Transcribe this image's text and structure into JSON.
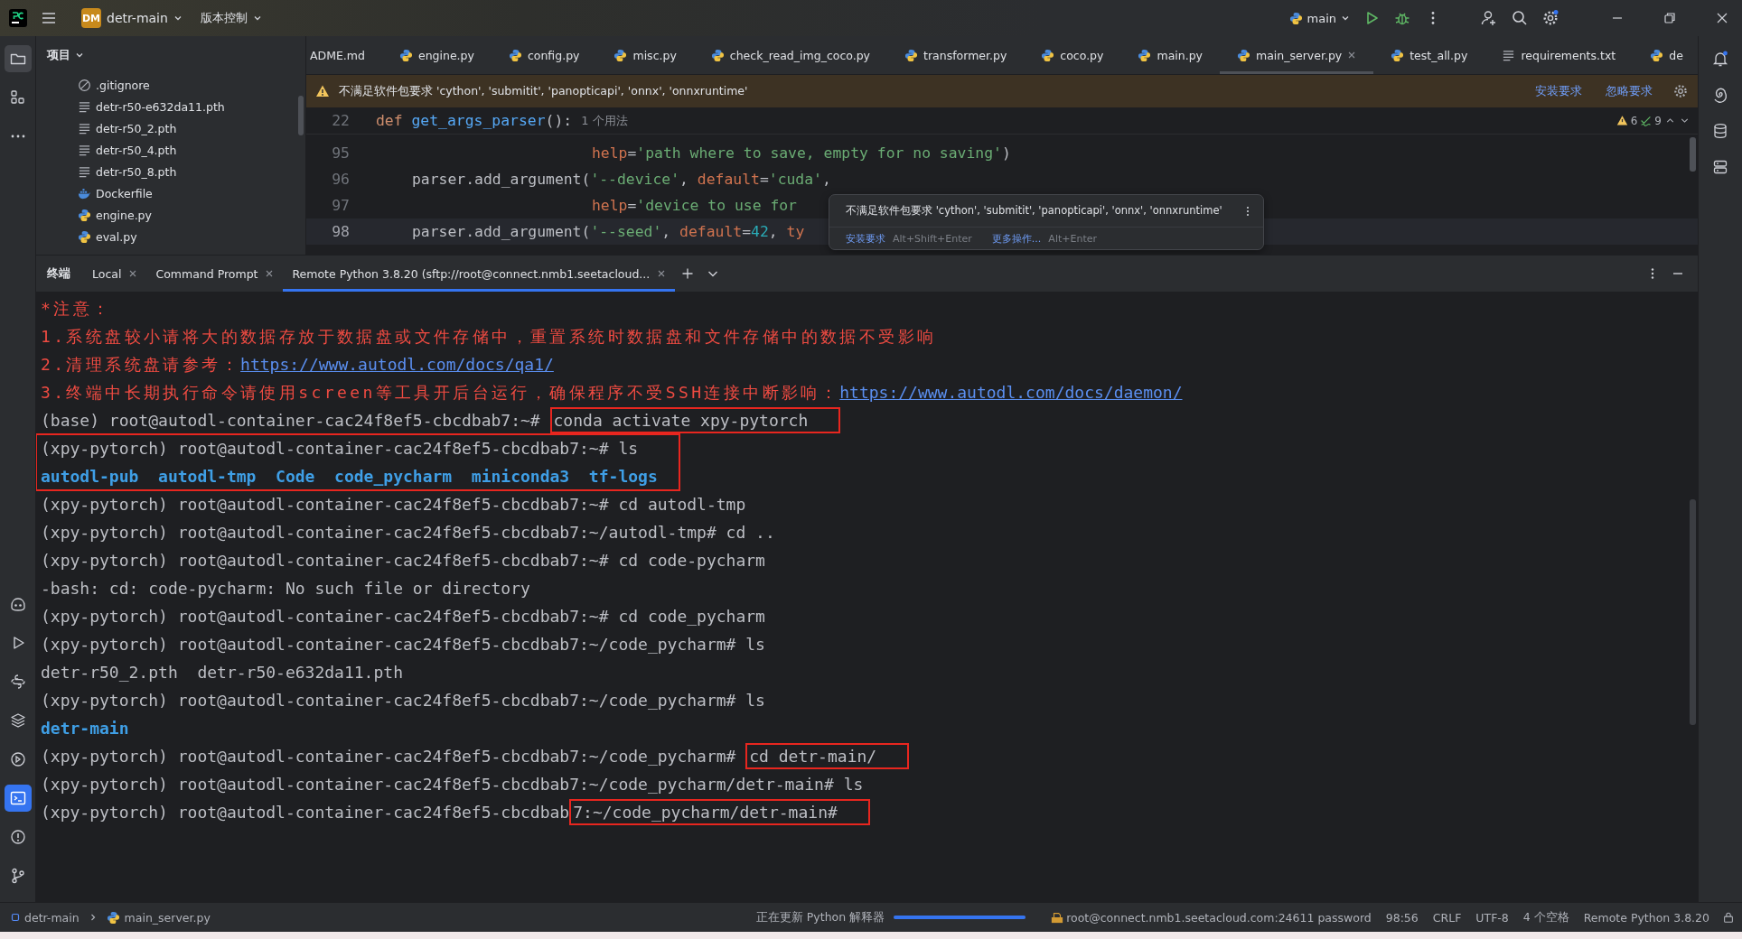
{
  "titlebar": {
    "project_badge": "DM",
    "project": "detr-main",
    "vcs": "版本控制",
    "run_config": "main"
  },
  "project_panel": {
    "title": "项目",
    "items": [
      {
        "name": ".gitignore",
        "kind": "ignore"
      },
      {
        "name": "detr-r50-e632da11.pth",
        "kind": "text"
      },
      {
        "name": "detr-r50_2.pth",
        "kind": "text"
      },
      {
        "name": "detr-r50_4.pth",
        "kind": "text"
      },
      {
        "name": "detr-r50_8.pth",
        "kind": "text"
      },
      {
        "name": "Dockerfile",
        "kind": "docker"
      },
      {
        "name": "engine.py",
        "kind": "python"
      },
      {
        "name": "eval.py",
        "kind": "python"
      }
    ]
  },
  "editor_tabs": [
    {
      "label": "ADME.md",
      "kind": "markdown",
      "selected": false
    },
    {
      "label": "engine.py",
      "kind": "python",
      "selected": false
    },
    {
      "label": "config.py",
      "kind": "python",
      "selected": false
    },
    {
      "label": "misc.py",
      "kind": "python",
      "selected": false
    },
    {
      "label": "check_read_img_coco.py",
      "kind": "python",
      "selected": false
    },
    {
      "label": "transformer.py",
      "kind": "python",
      "selected": false
    },
    {
      "label": "coco.py",
      "kind": "python",
      "selected": false
    },
    {
      "label": "main.py",
      "kind": "python",
      "selected": false
    },
    {
      "label": "main_server.py",
      "kind": "python",
      "selected": true
    },
    {
      "label": "test_all.py",
      "kind": "python",
      "selected": false
    },
    {
      "label": "requirements.txt",
      "kind": "text",
      "selected": false
    },
    {
      "label": "de",
      "kind": "python",
      "selected": false
    }
  ],
  "banner": {
    "message": "不满足软件包要求 'cython', 'submitit', 'panopticapi', 'onnx', 'onnxruntime'",
    "actions": [
      "安装要求",
      "忽略要求"
    ]
  },
  "inspections": {
    "warnings": "6",
    "weak_warnings": "9"
  },
  "editor": {
    "sticky": {
      "number": "22",
      "segments": [
        {
          "text": "def ",
          "kind": "keyword"
        },
        {
          "text": "get_args_parser",
          "kind": "function"
        },
        {
          "text": "():",
          "kind": "plain"
        }
      ],
      "hint": "1 个用法"
    },
    "lines": [
      {
        "number": "95",
        "kind": "continuation",
        "current": false,
        "segments": [
          {
            "text": "help",
            "kind": "param"
          },
          {
            "text": "=",
            "kind": "plain"
          },
          {
            "text": "'path where to save, empty for no saving'",
            "kind": "string"
          },
          {
            "text": ")",
            "kind": "plain"
          }
        ]
      },
      {
        "number": "96",
        "kind": "statement",
        "current": false,
        "segments": [
          {
            "text": "parser.add_argument(",
            "kind": "plain"
          },
          {
            "text": "'--device'",
            "kind": "string"
          },
          {
            "text": ", ",
            "kind": "plain"
          },
          {
            "text": "default",
            "kind": "param"
          },
          {
            "text": "=",
            "kind": "plain"
          },
          {
            "text": "'cuda'",
            "kind": "string"
          },
          {
            "text": ",",
            "kind": "plain"
          }
        ]
      },
      {
        "number": "97",
        "kind": "continuation",
        "current": false,
        "segments": [
          {
            "text": "help",
            "kind": "param"
          },
          {
            "text": "=",
            "kind": "plain"
          },
          {
            "text": "'device to use for",
            "kind": "string"
          }
        ]
      },
      {
        "number": "98",
        "kind": "statement",
        "current": true,
        "segments": [
          {
            "text": "parser.add_argument(",
            "kind": "plain"
          },
          {
            "text": "'--seed'",
            "kind": "string"
          },
          {
            "text": ", ",
            "kind": "plain"
          },
          {
            "text": "default",
            "kind": "param"
          },
          {
            "text": "=",
            "kind": "plain"
          },
          {
            "text": "42",
            "kind": "number"
          },
          {
            "text": ", ",
            "kind": "plain"
          },
          {
            "text": "ty",
            "kind": "param"
          }
        ]
      }
    ]
  },
  "popup": {
    "message": "不满足软件包要求 'cython', 'submitit', 'panopticapi', 'onnx', 'onnxruntime'",
    "actions": [
      {
        "label": "安装要求",
        "shortcut": "Alt+Shift+Enter"
      },
      {
        "label": "更多操作...",
        "shortcut": "Alt+Enter"
      }
    ]
  },
  "terminal": {
    "title": "终端",
    "tabs": [
      {
        "label": "Local",
        "selected": false
      },
      {
        "label": "Command Prompt",
        "selected": false
      },
      {
        "label": "Remote Python 3.8.20 (sftp://root@connect.nmb1.seetacloud...",
        "selected": true
      }
    ],
    "lines": [
      {
        "kind": "line",
        "segments": [
          {
            "text": "*注意：",
            "kind": "warning",
            "boxed": false
          }
        ]
      },
      {
        "kind": "line",
        "segments": [
          {
            "text": "1.系统盘较小请将大的数据存放于数据盘或文件存储中，重置系统时数据盘和文件存储中的数据不受影响",
            "kind": "warning",
            "boxed": false
          }
        ]
      },
      {
        "kind": "line",
        "segments": [
          {
            "text": "2.清理系统盘请参考：",
            "kind": "warning",
            "boxed": false
          },
          {
            "text": "https://www.autodl.com/docs/qa1/",
            "kind": "link",
            "boxed": false
          }
        ]
      },
      {
        "kind": "line",
        "segments": [
          {
            "text": "3.终端中长期执行命令请使用screen等工具开后台运行，确保程序不受SSH连接中断影响：",
            "kind": "warning",
            "boxed": false
          },
          {
            "text": "https://www.autodl.com/docs/daemon/",
            "kind": "link",
            "boxed": false
          }
        ]
      },
      {
        "kind": "line",
        "segments": [
          {
            "text": "(base) root@autodl-container-cac24f8ef5-cbcdbab7:~# ",
            "kind": "plain",
            "boxed": false
          },
          {
            "text": "conda activate xpy-pytorch",
            "kind": "plain",
            "boxed": true
          }
        ]
      },
      {
        "kind": "boxed_block",
        "lines": [
          {
            "segments": [
              {
                "text": "(xpy-pytorch) root@autodl-container-cac24f8ef5-cbcdbab7:~# ls",
                "kind": "plain",
                "boxed": false
              }
            ]
          },
          {
            "segments": [
              {
                "text": "autodl-pub  autodl-tmp  Code  code_pycharm  miniconda3  tf-logs",
                "kind": "dir",
                "boxed": false
              }
            ]
          }
        ]
      },
      {
        "kind": "line",
        "segments": [
          {
            "text": "(xpy-pytorch) root@autodl-container-cac24f8ef5-cbcdbab7:~# cd autodl-tmp",
            "kind": "plain",
            "boxed": false
          }
        ]
      },
      {
        "kind": "line",
        "segments": [
          {
            "text": "(xpy-pytorch) root@autodl-container-cac24f8ef5-cbcdbab7:~/autodl-tmp# cd ..",
            "kind": "plain",
            "boxed": false
          }
        ]
      },
      {
        "kind": "line",
        "segments": [
          {
            "text": "(xpy-pytorch) root@autodl-container-cac24f8ef5-cbcdbab7:~# cd code-pycharm",
            "kind": "plain",
            "boxed": false
          }
        ]
      },
      {
        "kind": "line",
        "segments": [
          {
            "text": "-bash: cd: code-pycharm: No such file or directory",
            "kind": "plain",
            "boxed": false
          }
        ]
      },
      {
        "kind": "line",
        "segments": [
          {
            "text": "(xpy-pytorch) root@autodl-container-cac24f8ef5-cbcdbab7:~# cd code_pycharm",
            "kind": "plain",
            "boxed": false
          }
        ]
      },
      {
        "kind": "line",
        "segments": [
          {
            "text": "(xpy-pytorch) root@autodl-container-cac24f8ef5-cbcdbab7:~/code_pycharm# ls",
            "kind": "plain",
            "boxed": false
          }
        ]
      },
      {
        "kind": "line",
        "segments": [
          {
            "text": "detr-r50_2.pth  detr-r50-e632da11.pth",
            "kind": "plain",
            "boxed": false
          }
        ]
      },
      {
        "kind": "line",
        "segments": [
          {
            "text": "(xpy-pytorch) root@autodl-container-cac24f8ef5-cbcdbab7:~/code_pycharm# ls",
            "kind": "plain",
            "boxed": false
          }
        ]
      },
      {
        "kind": "line",
        "segments": [
          {
            "text": "detr-main",
            "kind": "dir",
            "boxed": false
          }
        ]
      },
      {
        "kind": "line",
        "segments": [
          {
            "text": "(xpy-pytorch) root@autodl-container-cac24f8ef5-cbcdbab7:~/code_pycharm# ",
            "kind": "plain",
            "boxed": false
          },
          {
            "text": "cd detr-main/",
            "kind": "plain",
            "boxed": true
          }
        ]
      },
      {
        "kind": "line",
        "segments": [
          {
            "text": "(xpy-pytorch) root@autodl-container-cac24f8ef5-cbcdbab7:~/code_pycharm/detr-main# ls",
            "kind": "plain",
            "boxed": false
          }
        ]
      },
      {
        "kind": "line",
        "segments": [
          {
            "text": "(xpy-pytorch) root@autodl-container-cac24f8ef5-cbcdbab",
            "kind": "plain",
            "boxed": false
          },
          {
            "text": "7:~/code_pycharm/detr-main#",
            "kind": "plain",
            "boxed": true
          }
        ]
      }
    ]
  },
  "status_bar": {
    "breadcrumb": [
      "detr-main",
      "main_server.py"
    ],
    "task": "正在更新 Python 解释器",
    "progress": {
      "level": 1
    },
    "connection": "root@connect.nmb1.seetacloud.com:24611 password",
    "position": "98:56",
    "line_ending": "CRLF",
    "encoding": "UTF-8",
    "indent": "4 个空格",
    "interpreter": "Remote Python 3.8.20"
  }
}
